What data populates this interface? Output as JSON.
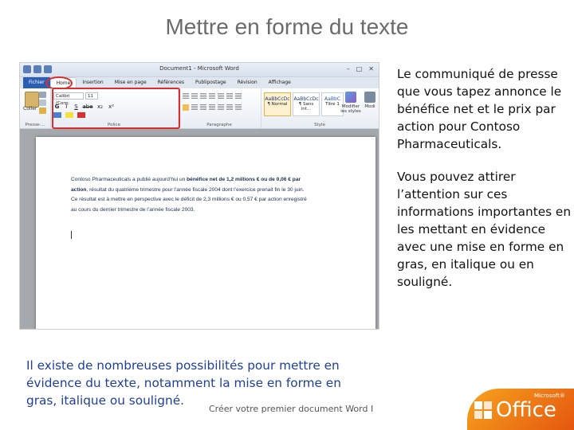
{
  "slide": {
    "title": "Mettre en forme du texte",
    "right_paragraphs": [
      "Le communiqué de presse que vous tapez annonce le bénéfice net et le prix par action pour Contoso Pharmaceuticals.",
      "Vous pouvez attirer l’attention sur ces informations importantes en les mettant en évidence avec une mise en forme en gras, en italique ou en souligné."
    ],
    "bottom_text": "Il existe de nombreuses possibilités pour mettre en évidence du texte, notamment la mise en forme en gras, italique ou souligné.",
    "footer": "Créer votre premier document Word I",
    "logo": {
      "word": "Office",
      "ms": "Microsoft®",
      "colors": [
        "#f7a41d",
        "#e5560f"
      ]
    }
  },
  "word": {
    "window_title": "Document1 - Microsoft Word",
    "tabs": [
      "Fichier",
      "Home",
      "Insertion",
      "Mise en page",
      "Références",
      "Publipostage",
      "Révision",
      "Affichage"
    ],
    "paste_label": "Coller",
    "font_name": "Calibri (Corp:",
    "font_size": "11",
    "format_glyphs": [
      "G",
      "I",
      "S",
      "abe",
      "x₂",
      "x²"
    ],
    "groups": {
      "clipboard": "Presse-...",
      "font": "Police",
      "paragraph": "Paragraphe",
      "styles": "Style"
    },
    "styles": [
      {
        "sample": "AaBbCcDc",
        "name": "¶ Normal"
      },
      {
        "sample": "AaBbCcDc",
        "name": "¶ Sans int..."
      },
      {
        "sample": "AaBbC",
        "name": "Titre 1"
      }
    ],
    "modify_styles": "Modifier les styles",
    "modify_label2": "Modi",
    "document": {
      "parts": [
        {
          "text": "Contoso Pharmaceuticals a publié aujourd’hui un ",
          "bold": false
        },
        {
          "text": "bénéfice net de 1,2 millions € ou de 0,06 € par action",
          "bold": true
        },
        {
          "text": ", résultat du quatrième trimestre pour l’année fiscale 2004 dont l’exercice prenait fin le 30 juin. Ce résultat est à mettre en perspective avec le déficit de 2,3 millions € ou 0,57 € par action enregistré au cours du dernier trimestre de l’année fiscale 2003.",
          "bold": false
        }
      ]
    },
    "accent_color": "#d9302f"
  }
}
